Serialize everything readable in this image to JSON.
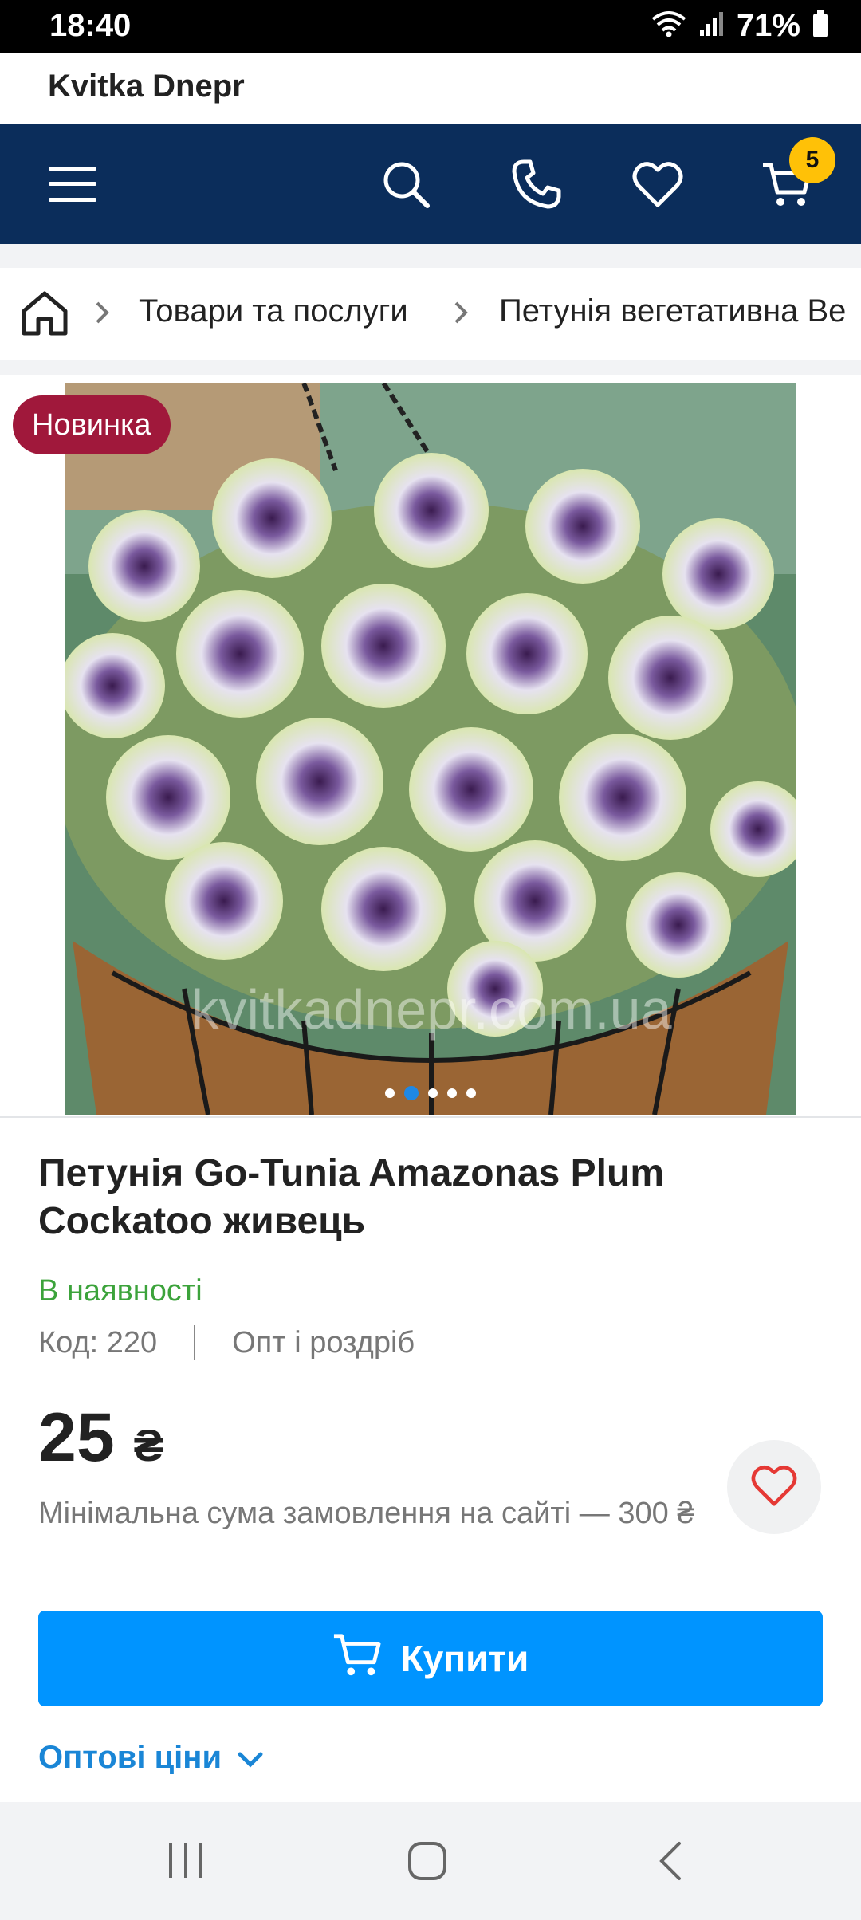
{
  "status_bar": {
    "time": "18:40",
    "battery": "71%",
    "icons": [
      "wifi-icon",
      "signal-icon",
      "battery-icon"
    ]
  },
  "site": {
    "title": "Kvitka Dnepr"
  },
  "nav": {
    "icons": [
      "menu-icon",
      "search-icon",
      "phone-icon",
      "heart-icon",
      "cart-icon"
    ],
    "cart_count": "5",
    "colors": {
      "background": "#0b2d5b",
      "badge": "#ffc107"
    }
  },
  "breadcrumbs": {
    "items": [
      "Товари та послуги",
      "Петунія вегетативна Ве"
    ]
  },
  "gallery": {
    "badge": "Новинка",
    "watermark": "kvitkadnepr.com.ua",
    "dots_total": 5,
    "active_dot": 2
  },
  "product": {
    "title": "Петунія Go-Tunia Amazonas Plum Cockatoo живець",
    "availability": "В наявності",
    "code": "Код: 220",
    "sale_type": "Опт і роздріб",
    "price": "25",
    "currency": "₴",
    "min_order": "Мінімальна сума замовлення на сайті — 300 ₴",
    "buy_label": "Купити",
    "wholesale_label": "Оптові ціни",
    "colors": {
      "buy": "#0094ff",
      "in_stock": "#3ca33b",
      "badge_new": "#a0183b"
    }
  },
  "system_nav": {
    "icons": [
      "recent-apps-icon",
      "home-icon",
      "back-icon"
    ]
  }
}
